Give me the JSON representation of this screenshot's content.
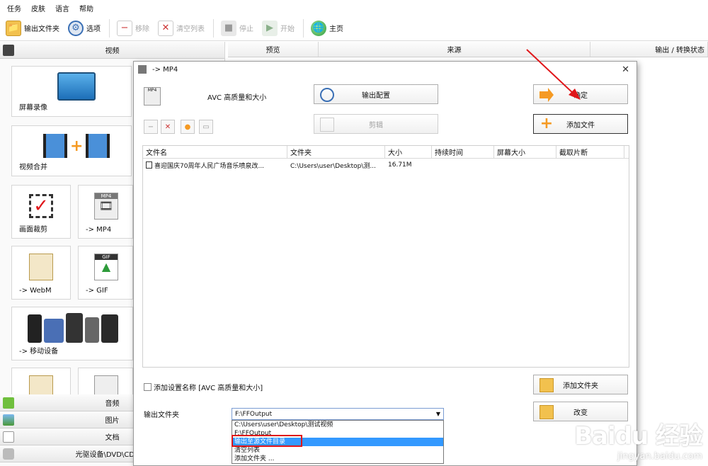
{
  "menu": [
    "任务",
    "皮肤",
    "语言",
    "帮助"
  ],
  "toolbar": [
    {
      "label": "输出文件夹",
      "icon": "folder-icon",
      "disabled": false
    },
    {
      "label": "选项",
      "icon": "gear-icon",
      "disabled": false
    },
    {
      "label": "移除",
      "icon": "remove-icon",
      "disabled": true
    },
    {
      "label": "清空列表",
      "icon": "clear-list-icon",
      "disabled": true
    },
    {
      "label": "停止",
      "icon": "stop-icon",
      "disabled": true
    },
    {
      "label": "开始",
      "icon": "start-icon",
      "disabled": true
    },
    {
      "label": "主页",
      "icon": "home-globe-icon",
      "disabled": false
    }
  ],
  "sidebar": {
    "video_header": "视频",
    "tiles": [
      "屏幕录像",
      "视频合并",
      "画面裁剪",
      "-> MP4",
      "-> WebM",
      "-> GIF",
      "-> 移动设备"
    ],
    "categories": [
      "音频",
      "图片",
      "文档",
      "光驱设备\\DVD\\CD\\ISO"
    ]
  },
  "main_columns": [
    "预览",
    "来源",
    "输出 / 转换状态"
  ],
  "dialog": {
    "title": "-> MP4",
    "preset": "AVC 高质量和大小",
    "output_config_label": "输出配置",
    "edit_label": "剪辑",
    "ok_label": "确定",
    "add_file_label": "添加文件",
    "add_folder_label": "添加文件夹",
    "change_label": "改变",
    "columns": [
      "文件名",
      "文件夹",
      "大小",
      "持续时间",
      "屏幕大小",
      "截取片断"
    ],
    "files": [
      {
        "name": "喜迎国庆70周年人民广场音乐喷泉改...",
        "folder": "C:\\Users\\user\\Desktop\\测...",
        "size": "16.71M",
        "duration": "",
        "screen": "",
        "clip": ""
      }
    ],
    "checkbox_label": "添加设置名称 [AVC 高质量和大小]",
    "output_folder_label": "输出文件夹",
    "output_folder_value": "F:\\FFOutput",
    "dropdown_options": [
      "C:\\Users\\user\\Desktop\\测试视频",
      "F:\\FFOutput",
      "输出至源文件目录",
      "清空列表",
      "添加文件夹 ..."
    ],
    "selected_option_index": 2
  },
  "watermark": {
    "logo": "Baidu 经验",
    "url": "jingyan.baidu.com"
  },
  "colors": {
    "accent_red": "#e0161a",
    "selection_blue": "#3399ff",
    "orange": "#f59a23"
  }
}
